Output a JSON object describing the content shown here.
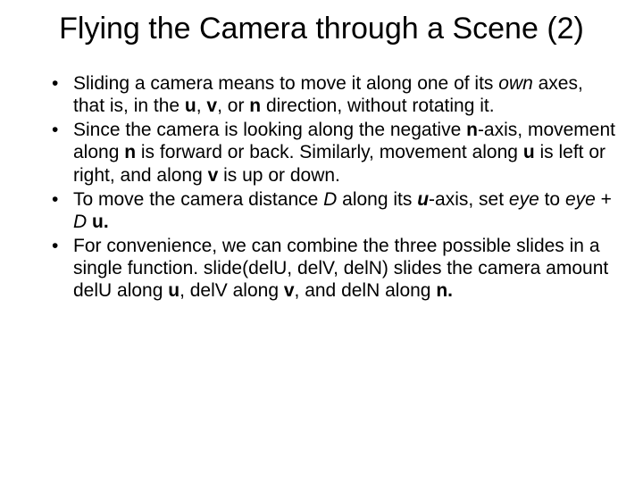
{
  "title": "Flying the Camera through a Scene (2)",
  "b1": {
    "t1": "Sliding a camera means to move it along one of its ",
    "own": "own",
    "t2": " axes, that is, in the ",
    "u": "u",
    "c1": ", ",
    "v": "v",
    "c2": ", or ",
    "n": "n",
    "t3": " direction, without rotating it."
  },
  "b2": {
    "t1": "Since the camera is looking along the negative ",
    "n1": "n",
    "t2": "-axis, movement along ",
    "n2": "n",
    "t3": " is forward or back. Similarly, movement along ",
    "u": "u",
    "t4": " is left or right, and along ",
    "v": "v",
    "t5": " is up or down."
  },
  "b3": {
    "t1": "To move the camera distance ",
    "D": "D",
    "t2": " along its ",
    "u1": "u",
    "t3": "-axis, set ",
    "eye1": "eye",
    "t4": " to ",
    "eye2": "eye",
    "t5": " + ",
    "D2": "D",
    "sp": " ",
    "u2": "u."
  },
  "b4": {
    "t1": "For convenience, we can combine the three possible slides in a single function. slide(delU, delV, delN) slides the camera amount delU along ",
    "u": "u",
    "t2": ", delV along ",
    "v": "v",
    "t3": ", and delN along ",
    "n": "n."
  }
}
